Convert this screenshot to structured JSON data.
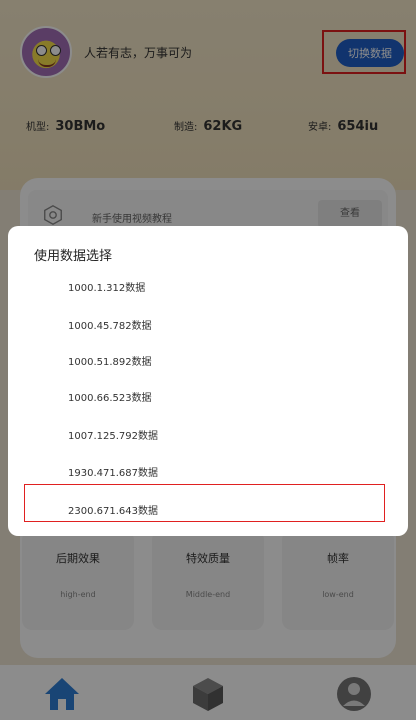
{
  "profile": {
    "slogan": "人若有志，万事可为",
    "switch_button": "切换数据"
  },
  "stats": [
    {
      "label": "机型:",
      "value": "30BMo"
    },
    {
      "label": "制造:",
      "value": "62KG"
    },
    {
      "label": "安卓:",
      "value": "654iu"
    }
  ],
  "tutorial": {
    "text": "新手使用视频教程",
    "button": "查看"
  },
  "cards": [
    {
      "title": "后期效果",
      "sub": "high-end"
    },
    {
      "title": "特效质量",
      "sub": "Middle-end"
    },
    {
      "title": "帧率",
      "sub": "low-end"
    }
  ],
  "dialog": {
    "title": "使用数据选择",
    "options": [
      "1000.1.312数据",
      "1000.45.782数据",
      "1000.51.892数据",
      "1000.66.523数据",
      "1007.125.792数据",
      "1930.471.687数据",
      "2300.671.643数据"
    ],
    "highlighted_index": 6
  },
  "colors": {
    "accent": "#1f5fc8",
    "highlight": "#e02020",
    "nav_home": "#2f7fd6"
  },
  "nav": {
    "items": [
      "home-icon",
      "cube-icon",
      "profile-icon"
    ]
  }
}
